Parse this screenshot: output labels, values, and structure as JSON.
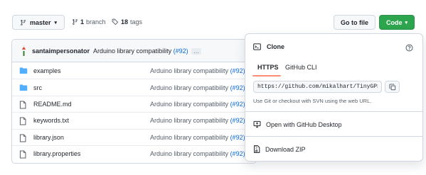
{
  "toolbar": {
    "branch_label": "master",
    "branch_count": "1",
    "branch_word": "branch",
    "tag_count": "18",
    "tag_word": "tags",
    "goto_label": "Go to file",
    "code_label": "Code"
  },
  "commit": {
    "author": "santaimpersonator",
    "message": "Arduino library compatibility",
    "pr": "(#92)",
    "more": "…"
  },
  "files": [
    {
      "name": "examples",
      "type": "folder",
      "msg": "Arduino library compatibility",
      "pr": "(#92)"
    },
    {
      "name": "src",
      "type": "folder",
      "msg": "Arduino library compatibility",
      "pr": "(#92)"
    },
    {
      "name": "README.md",
      "type": "file",
      "msg": "Arduino library compatibility",
      "pr": "(#92)"
    },
    {
      "name": "keywords.txt",
      "type": "file",
      "msg": "Arduino library compatibility",
      "pr": "(#92)"
    },
    {
      "name": "library.json",
      "type": "file",
      "msg": "Arduino library compatibility",
      "pr": "(#92)"
    },
    {
      "name": "library.properties",
      "type": "file",
      "msg": "Arduino library compatibility",
      "pr": "(#92)"
    }
  ],
  "dropdown": {
    "title": "Clone",
    "tabs": [
      "HTTPS",
      "GitHub CLI"
    ],
    "url": "https://github.com/mikalhart/TinyGPSPlus.git",
    "hint": "Use Git or checkout with SVN using the web URL.",
    "desktop_label": "Open with GitHub Desktop",
    "zip_label": "Download ZIP"
  },
  "colors": {
    "code_button": "#2da44e",
    "link": "#0969da",
    "folder": "#54aeff",
    "tab_underline": "#fd8c73"
  },
  "icons": {
    "branch": "git-branch-icon",
    "tag": "tag-icon",
    "folder": "folder-icon",
    "file": "file-icon",
    "terminal": "terminal-icon",
    "help": "question-icon",
    "copy": "copy-icon",
    "desktop": "desktop-icon",
    "zip": "file-zip-icon"
  }
}
